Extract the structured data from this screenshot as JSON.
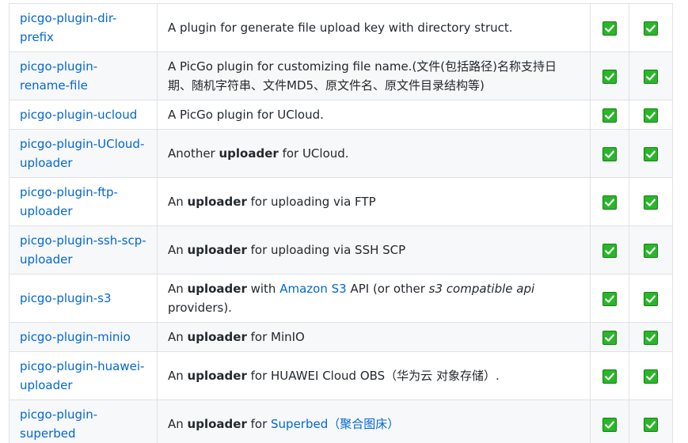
{
  "rows": [
    {
      "name": "picgo-plugin-dir-prefix",
      "desc": {
        "pre": "A plugin for generate file upload key with directory struct.",
        "bold": "",
        "mid": "",
        "link": "",
        "mid2": "",
        "italic": "",
        "post": ""
      }
    },
    {
      "name": "picgo-plugin-rename-file",
      "desc": {
        "pre": "A PicGo plugin for customizing file name.(文件(包括路径)名称支持日期、随机字符串、文件MD5、原文件名、原文件目录结构等)",
        "bold": "",
        "mid": "",
        "link": "",
        "mid2": "",
        "italic": "",
        "post": ""
      }
    },
    {
      "name": "picgo-plugin-ucloud",
      "desc": {
        "pre": "A PicGo plugin for UCloud.",
        "bold": "",
        "mid": "",
        "link": "",
        "mid2": "",
        "italic": "",
        "post": ""
      }
    },
    {
      "name": "picgo-plugin-UCloud-uploader",
      "desc": {
        "pre": "Another ",
        "bold": "uploader",
        "mid": " for UCloud.",
        "link": "",
        "mid2": "",
        "italic": "",
        "post": ""
      }
    },
    {
      "name": "picgo-plugin-ftp-uploader",
      "desc": {
        "pre": "An ",
        "bold": "uploader",
        "mid": " for uploading via FTP",
        "link": "",
        "mid2": "",
        "italic": "",
        "post": ""
      }
    },
    {
      "name": "picgo-plugin-ssh-scp-uploader",
      "desc": {
        "pre": "An ",
        "bold": "uploader",
        "mid": " for uploading via SSH SCP",
        "link": "",
        "mid2": "",
        "italic": "",
        "post": ""
      }
    },
    {
      "name": "picgo-plugin-s3",
      "desc": {
        "pre": "An ",
        "bold": "uploader",
        "mid": " with ",
        "link": "Amazon S3",
        "mid2": " API (or other ",
        "italic": "s3 compatible api",
        "post": " providers)."
      }
    },
    {
      "name": "picgo-plugin-minio",
      "desc": {
        "pre": "An ",
        "bold": "uploader",
        "mid": " for MinIO",
        "link": "",
        "mid2": "",
        "italic": "",
        "post": ""
      }
    },
    {
      "name": "picgo-plugin-huawei-uploader",
      "desc": {
        "pre": "An ",
        "bold": "uploader",
        "mid": " for HUAWEI Cloud OBS（华为云 对象存储）.",
        "link": "",
        "mid2": "",
        "italic": "",
        "post": ""
      }
    },
    {
      "name": "picgo-plugin-superbed",
      "desc": {
        "pre": "An ",
        "bold": "uploader",
        "mid": " for ",
        "link": "Superbed（聚合图床）",
        "mid2": "",
        "italic": "",
        "post": ""
      }
    }
  ],
  "colors": {
    "link": "#0366d6",
    "check_green": "#2ab62a",
    "border": "#dfe2e5",
    "stripe": "#f6f8fa"
  },
  "icons": {
    "check": "check-mark-icon"
  }
}
